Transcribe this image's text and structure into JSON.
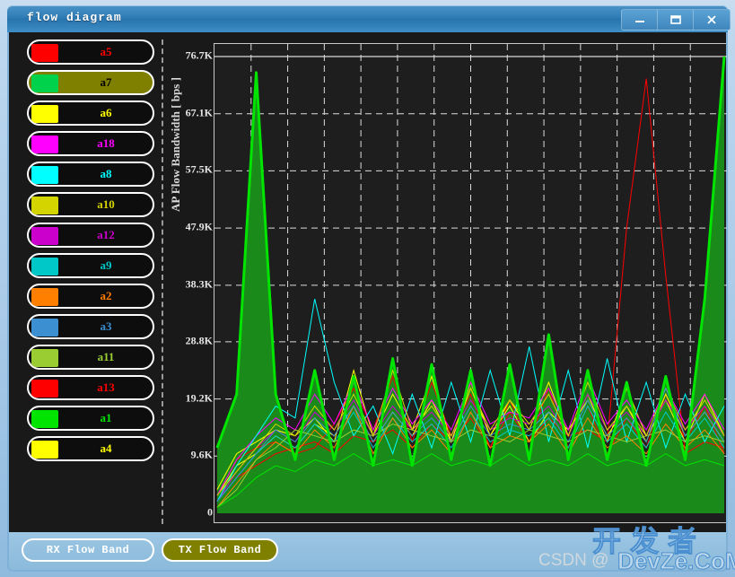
{
  "window": {
    "title": "flow diagram",
    "minimize_label": "–",
    "maximize_label": "□",
    "close_label": "×"
  },
  "legend": {
    "items": [
      {
        "label": "a5",
        "color": "#ff0000",
        "selected": false
      },
      {
        "label": "a7",
        "color": "#00d24c",
        "selected": true
      },
      {
        "label": "a6",
        "color": "#ffff00",
        "selected": false
      },
      {
        "label": "a18",
        "color": "#ff00ff",
        "selected": false
      },
      {
        "label": "a8",
        "color": "#00ffff",
        "selected": false
      },
      {
        "label": "a10",
        "color": "#d4d400",
        "selected": false
      },
      {
        "label": "a12",
        "color": "#cc00cc",
        "selected": false
      },
      {
        "label": "a9",
        "color": "#00c8c8",
        "selected": false
      },
      {
        "label": "a2",
        "color": "#ff7f00",
        "selected": false
      },
      {
        "label": "a3",
        "color": "#3c8fd0",
        "selected": false
      },
      {
        "label": "a11",
        "color": "#9acd32",
        "selected": false
      },
      {
        "label": "a13",
        "color": "#ff0000",
        "selected": false
      },
      {
        "label": "a1",
        "color": "#00e400",
        "selected": false
      },
      {
        "label": "a4",
        "color": "#ffff00",
        "selected": false
      }
    ]
  },
  "buttons": {
    "rx": "RX Flow Band",
    "tx": "TX Flow Band"
  },
  "watermark": {
    "cn": "开发者",
    "csdn": "CSDN @",
    "devze": "DevZe.CoM"
  },
  "chart_data": {
    "type": "line",
    "title": "",
    "xlabel": "",
    "ylabel": "AP Flow Bandwidth [ bps ]",
    "ylim": [
      0,
      76700
    ],
    "ytick_labels": [
      "76.7K",
      "67.1K",
      "57.5K",
      "47.9K",
      "38.3K",
      "28.8K",
      "19.2K",
      "9.6K",
      "0"
    ],
    "ytick_values": [
      76700,
      67100,
      57500,
      47900,
      38300,
      28800,
      19200,
      9600,
      0
    ],
    "grid": true,
    "grid_style": "dashed",
    "grid_color": "#dcdcdc",
    "background": "#1e1e1e",
    "legend_position": "left-panel",
    "x_count": 27,
    "x_gridline_count": 13,
    "series": [
      {
        "name": "a7",
        "color": "#00e400",
        "fill": "#1a8a1a",
        "width": 3,
        "values": [
          11000,
          20000,
          74000,
          20000,
          9000,
          24000,
          9000,
          23000,
          8000,
          26000,
          8000,
          25000,
          9000,
          24000,
          8000,
          25000,
          9000,
          30000,
          9000,
          24000,
          9000,
          22000,
          8000,
          23000,
          9000,
          36000,
          76700
        ]
      },
      {
        "name": "a5",
        "color": "#ff0000",
        "width": 1,
        "values": [
          3000,
          9000,
          11000,
          12000,
          10000,
          11000,
          15000,
          21000,
          14000,
          23000,
          12000,
          22000,
          13000,
          20000,
          11000,
          19000,
          12000,
          21000,
          11000,
          18000,
          10000,
          16000,
          11000,
          20000,
          12000,
          18000,
          10000
        ]
      },
      {
        "name": "a13",
        "color": "#ff0000",
        "width": 1,
        "values": [
          2000,
          6000,
          8000,
          10000,
          11000,
          12000,
          10000,
          13000,
          12000,
          14000,
          11000,
          15000,
          12000,
          16000,
          11000,
          17000,
          12000,
          16000,
          13000,
          14000,
          12000,
          48000,
          73000,
          40000,
          10000,
          12000,
          11000
        ]
      },
      {
        "name": "a6",
        "color": "#ffff00",
        "width": 1,
        "values": [
          4000,
          10000,
          12000,
          14000,
          13000,
          16000,
          12000,
          24000,
          13000,
          20000,
          14000,
          23000,
          12000,
          21000,
          13000,
          19000,
          14000,
          22000,
          13000,
          20000,
          12000,
          21000,
          13000,
          19000,
          12000,
          20000,
          13000
        ]
      },
      {
        "name": "a4",
        "color": "#ffff00",
        "width": 1,
        "values": [
          3000,
          8000,
          10000,
          13000,
          11000,
          15000,
          13000,
          18000,
          12000,
          17000,
          13000,
          19000,
          12000,
          22000,
          13000,
          18000,
          12000,
          17000,
          14000,
          19000,
          13000,
          18000,
          12000,
          20000,
          13000,
          17000,
          12000
        ]
      },
      {
        "name": "a18",
        "color": "#ff00ff",
        "width": 1,
        "values": [
          3000,
          9000,
          13000,
          16000,
          14000,
          20000,
          15000,
          22000,
          14000,
          21000,
          15000,
          19000,
          14000,
          22000,
          15000,
          17000,
          16000,
          21000,
          14000,
          23000,
          15000,
          19000,
          14000,
          21000,
          15000,
          20000,
          14000
        ]
      },
      {
        "name": "a12",
        "color": "#cc00cc",
        "width": 1,
        "values": [
          2000,
          7000,
          11000,
          14000,
          12000,
          17000,
          14000,
          19000,
          13000,
          18000,
          14000,
          17000,
          13000,
          19000,
          14000,
          16000,
          15000,
          18000,
          13000,
          20000,
          14000,
          17000,
          13000,
          19000,
          14000,
          18000,
          13000
        ]
      },
      {
        "name": "a8",
        "color": "#00ffff",
        "width": 1,
        "values": [
          2000,
          8000,
          13000,
          18000,
          16000,
          36000,
          22000,
          13000,
          18000,
          10000,
          20000,
          11000,
          22000,
          12000,
          24000,
          13000,
          28000,
          12000,
          24000,
          11000,
          26000,
          12000,
          22000,
          11000,
          20000,
          12000,
          18000
        ]
      },
      {
        "name": "a9",
        "color": "#00c8c8",
        "width": 1,
        "values": [
          2000,
          6000,
          10000,
          13000,
          11000,
          15000,
          12000,
          17000,
          11000,
          16000,
          12000,
          15000,
          11000,
          17000,
          12000,
          14000,
          13000,
          16000,
          11000,
          18000,
          12000,
          15000,
          11000,
          17000,
          12000,
          16000,
          11000
        ]
      },
      {
        "name": "a10",
        "color": "#d4d400",
        "width": 1,
        "values": [
          3000,
          7000,
          11000,
          15000,
          13000,
          18000,
          14000,
          20000,
          13000,
          24000,
          14000,
          18000,
          13000,
          21000,
          14000,
          19000,
          15000,
          20000,
          13000,
          22000,
          14000,
          18000,
          13000,
          21000,
          14000,
          19000,
          13000
        ]
      },
      {
        "name": "a2",
        "color": "#ff7f00",
        "width": 1,
        "values": [
          1000,
          5000,
          9000,
          12000,
          10000,
          14000,
          11000,
          18000,
          10000,
          16000,
          11000,
          14000,
          10000,
          17000,
          11000,
          13000,
          12000,
          15000,
          10000,
          16000,
          11000,
          13000,
          10000,
          15000,
          11000,
          14000,
          10000
        ]
      },
      {
        "name": "a3",
        "color": "#3c8fd0",
        "width": 1,
        "values": [
          2000,
          6000,
          10000,
          14000,
          12000,
          16000,
          13000,
          18000,
          12000,
          17000,
          13000,
          16000,
          12000,
          18000,
          13000,
          15000,
          14000,
          17000,
          12000,
          19000,
          13000,
          16000,
          12000,
          21000,
          13000,
          17000,
          12000
        ]
      },
      {
        "name": "a11",
        "color": "#9acd32",
        "width": 1,
        "values": [
          1000,
          4000,
          9000,
          11000,
          14000,
          13000,
          12000,
          14000,
          13000,
          15000,
          14000,
          13000,
          12000,
          14000,
          13000,
          12000,
          14000,
          13000,
          12000,
          14000,
          13000,
          12000,
          13000,
          14000,
          12000,
          13000,
          12000
        ]
      },
      {
        "name": "a1",
        "color": "#00e400",
        "width": 1,
        "values": [
          1000,
          3000,
          6000,
          8000,
          7000,
          9000,
          8000,
          10000,
          8000,
          9000,
          8000,
          10000,
          8000,
          9000,
          8000,
          10000,
          8000,
          9000,
          8000,
          10000,
          8000,
          9000,
          8000,
          10000,
          8000,
          9000,
          8000
        ]
      }
    ]
  }
}
